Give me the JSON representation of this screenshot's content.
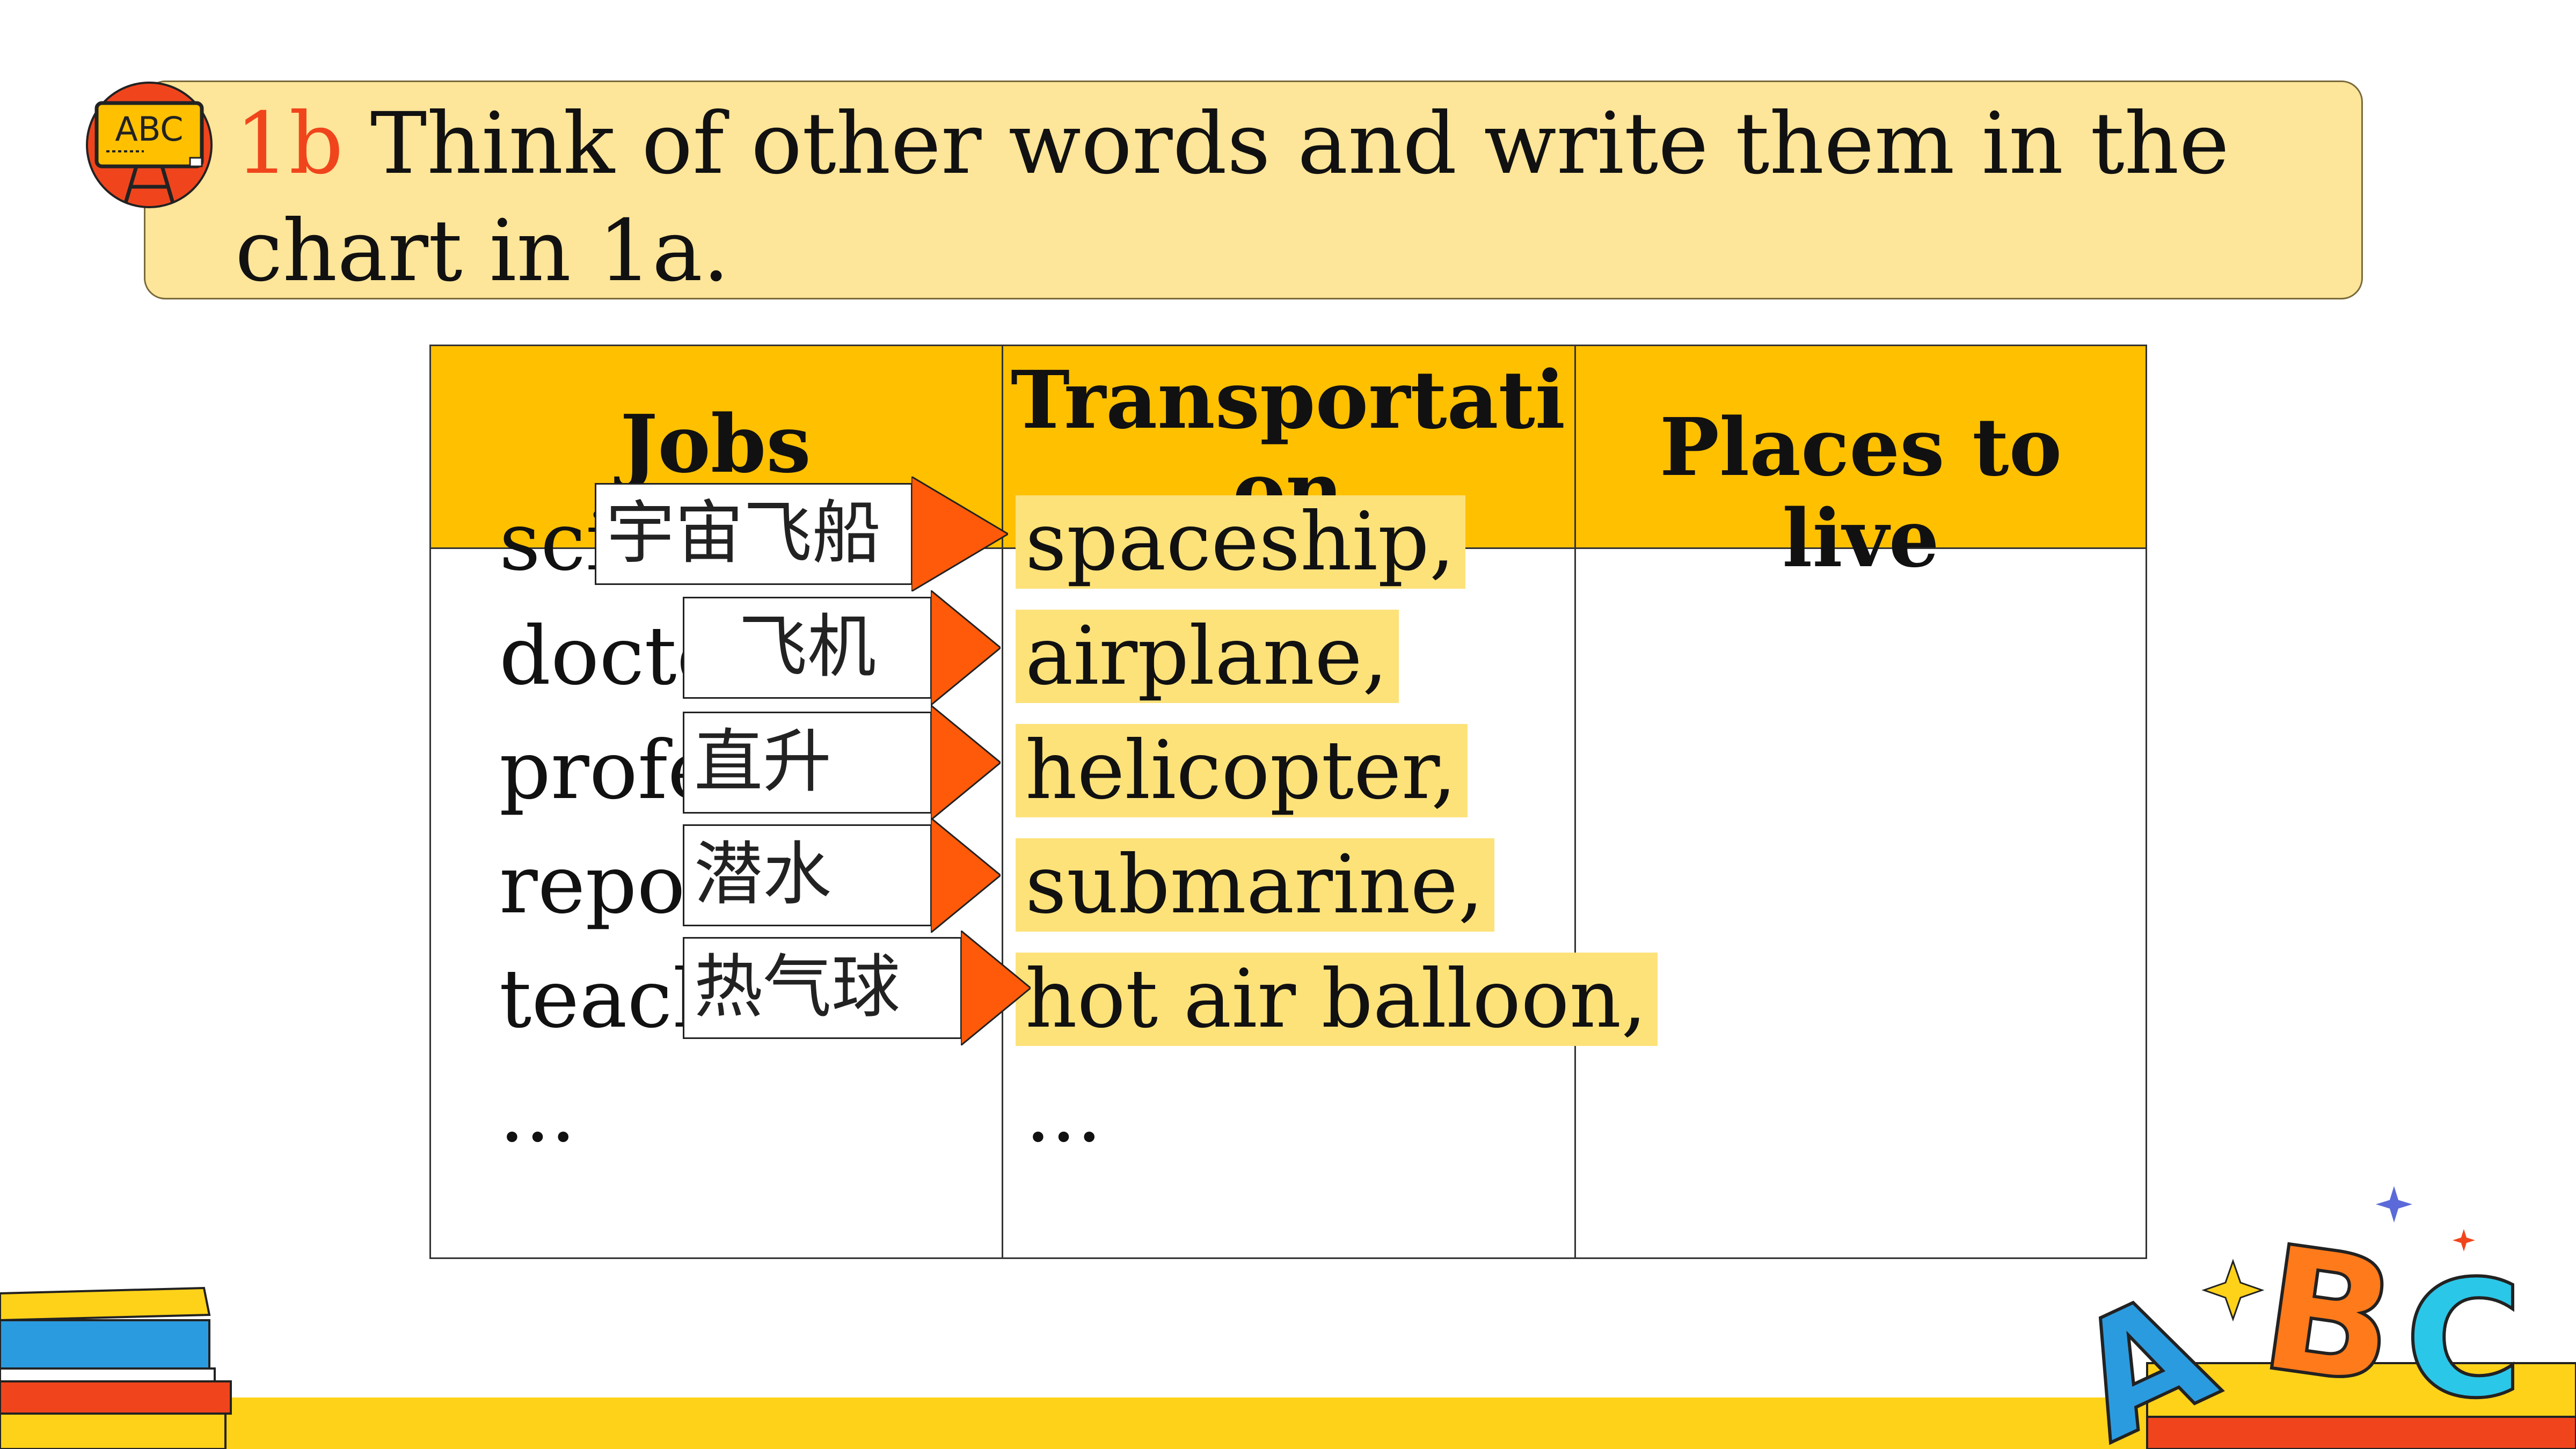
{
  "header": {
    "tag": "1b",
    "instruction": "Think of other words and write them in the chart in 1a."
  },
  "badge": {
    "icon": "abc-board-icon",
    "text": "ABC"
  },
  "table": {
    "headers": [
      "Jobs",
      "Transportation",
      "Places to live"
    ],
    "jobs_visible": [
      "sci",
      "docto",
      "profe",
      "repo",
      "teach",
      "..."
    ],
    "transportation": [
      "spaceship,",
      "airplane,",
      "helicopter,",
      "submarine,",
      "hot air balloon,",
      "..."
    ]
  },
  "callouts": [
    "宇宙飞船",
    "飞机",
    "直升",
    "潜水",
    "热气球"
  ],
  "colors": {
    "banner": "#fde599",
    "header_fill": "#ffc000",
    "highlight": "#fde27a",
    "accent_red": "#f0451c",
    "arrow": "#ff5a0a"
  },
  "decor": {
    "letters": [
      "A",
      "B",
      "C"
    ]
  }
}
